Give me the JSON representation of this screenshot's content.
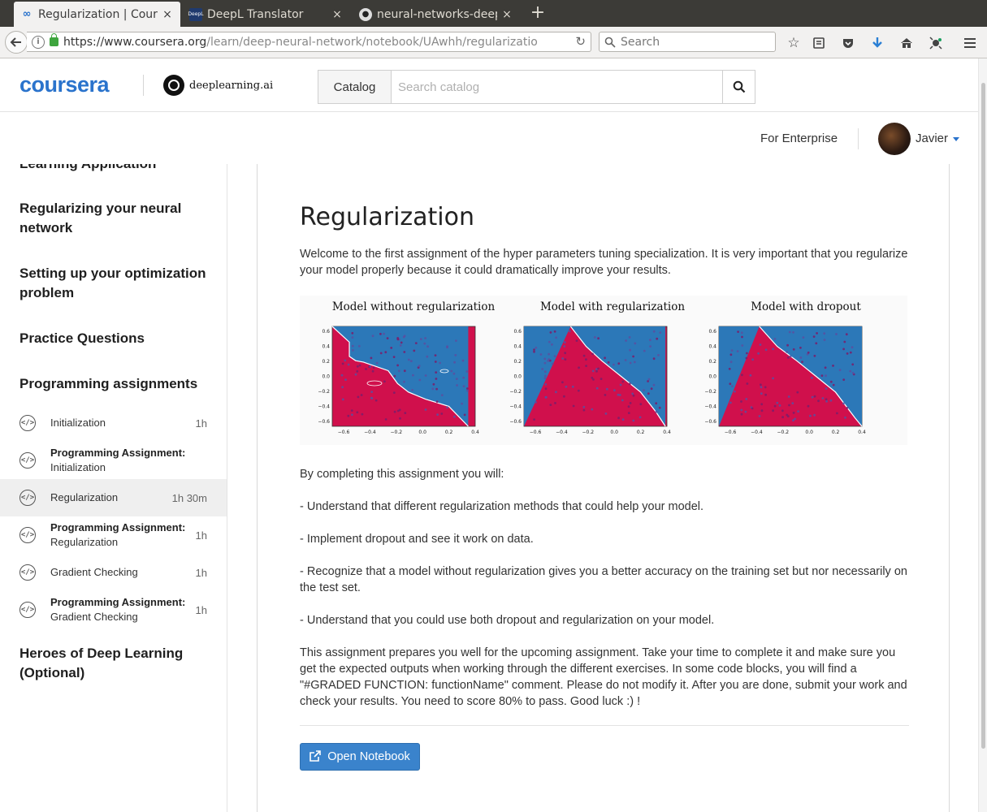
{
  "browser": {
    "tabs": [
      {
        "label": "Regularization | Cours",
        "icon": "coursera-icon",
        "active": true
      },
      {
        "label": "DeepL Translator",
        "icon": "deepl-icon",
        "active": false
      },
      {
        "label": "neural-networks-deep",
        "icon": "github-icon",
        "active": false
      }
    ],
    "close_glyph": "×",
    "newtab_glyph": "+",
    "url_host": "https://www.coursera.org",
    "url_path": "/learn/deep-neural-network/notebook/UAwhh/regularizatio",
    "search_placeholder": "Search"
  },
  "header": {
    "logo": "coursera",
    "partner": "deeplearning.ai",
    "catalog_label": "Catalog",
    "catalog_placeholder": "Search catalog",
    "enterprise": "For Enterprise",
    "username": "Javier"
  },
  "sidebar": {
    "cutoff_title": "Learning Application",
    "sections": [
      {
        "title": "Regularizing your neural network"
      },
      {
        "title": "Setting up your optimization problem"
      },
      {
        "title": "Practice Questions"
      },
      {
        "title": "Programming assignments"
      }
    ],
    "items": [
      {
        "title": "",
        "label": "Initialization",
        "duration": "1h"
      },
      {
        "title": "Programming Assignment:",
        "label": "Initialization",
        "duration": ""
      },
      {
        "title": "",
        "label": "Regularization",
        "duration": "1h 30m"
      },
      {
        "title": "Programming Assignment:",
        "label": "Regularization",
        "duration": "1h"
      },
      {
        "title": "",
        "label": "Gradient Checking",
        "duration": "1h"
      },
      {
        "title": "Programming Assignment:",
        "label": "Gradient Checking",
        "duration": "1h"
      }
    ],
    "last_section": "Heroes of Deep Learning (Optional)"
  },
  "main": {
    "title": "Regularization",
    "intro": "Welcome to the first assignment of the hyper parameters tuning specialization. It is very important that you regularize your model properly because it could dramatically improve your results.",
    "figure": {
      "panels": [
        {
          "title": "Model without regularization"
        },
        {
          "title": "Model with regularization"
        },
        {
          "title": "Model with dropout"
        }
      ],
      "y_ticks": [
        "0.6",
        "0.4",
        "0.2",
        "0.0",
        "−0.2",
        "−0.4",
        "−0.6"
      ],
      "x_ticks": [
        "−0.6",
        "−0.4",
        "−0.2",
        "0.0",
        "0.2",
        "0.4"
      ],
      "colors": {
        "blue": "#2c78b8",
        "red": "#d0104c"
      }
    },
    "completing": "By completing this assignment you will:",
    "bullets": [
      "- Understand that different regularization methods that could help your model.",
      "- Implement dropout and see it work on data.",
      "- Recognize that a model without regularization gives you a better accuracy on the training set but nor necessarily on the test set.",
      "- Understand that you could use both dropout and regularization on your model."
    ],
    "outro": "This assignment prepares you well for the upcoming assignment. Take your time to complete it and make sure you get the expected outputs when working through the different exercises. In some code blocks, you will find a \"#GRADED FUNCTION: functionName\" comment. Please do not modify it. After you are done, submit your work and check your results. You need to score 80% to pass. Good luck :) !",
    "button": "Open Notebook"
  }
}
